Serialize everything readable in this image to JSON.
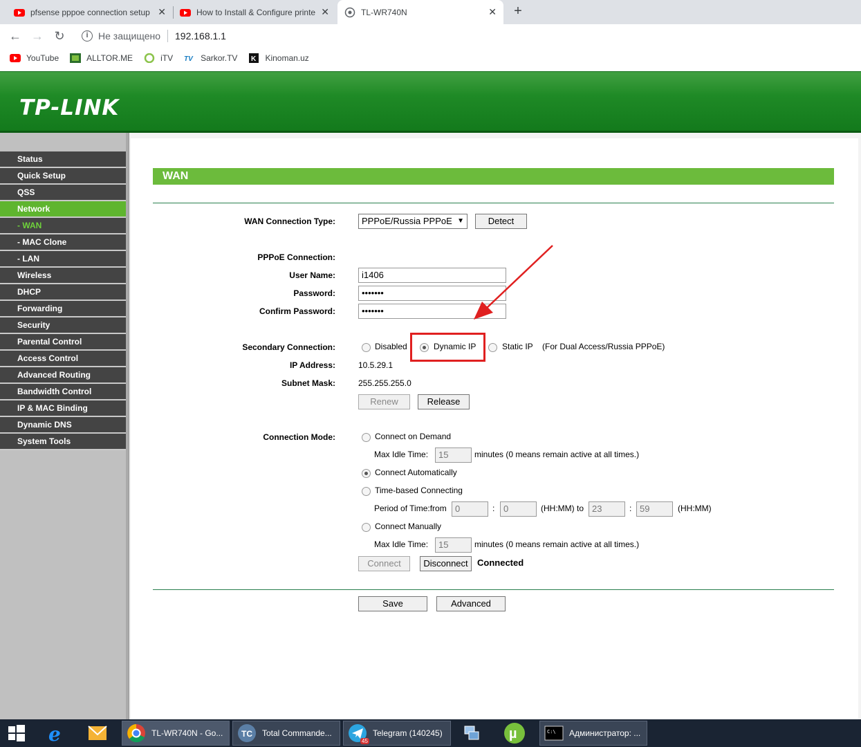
{
  "browser": {
    "tabs": [
      {
        "title": "pfsense pppoe connection setup",
        "icon": "youtube-icon"
      },
      {
        "title": "How to Install & Configure printe",
        "icon": "youtube-icon"
      },
      {
        "title": "TL-WR740N",
        "icon": "globe-icon"
      }
    ],
    "address": {
      "security": "Не защищено",
      "url": "192.168.1.1"
    },
    "bookmarks": [
      {
        "label": "YouTube",
        "icon": "youtube-icon"
      },
      {
        "label": "ALLTOR.ME",
        "icon": "alltor-icon"
      },
      {
        "label": "iTV",
        "icon": "itv-icon"
      },
      {
        "label": "Sarkor.TV",
        "icon": "sarkor-icon"
      },
      {
        "label": "Kinoman.uz",
        "icon": "kinoman-icon"
      }
    ]
  },
  "router": {
    "logo": "TP-LINK",
    "menu": [
      {
        "label": "Status"
      },
      {
        "label": "Quick Setup"
      },
      {
        "label": "QSS"
      },
      {
        "label": "Network"
      },
      {
        "label": "- WAN"
      },
      {
        "label": "- MAC Clone"
      },
      {
        "label": "- LAN"
      },
      {
        "label": "Wireless"
      },
      {
        "label": "DHCP"
      },
      {
        "label": "Forwarding"
      },
      {
        "label": "Security"
      },
      {
        "label": "Parental Control"
      },
      {
        "label": "Access Control"
      },
      {
        "label": "Advanced Routing"
      },
      {
        "label": "Bandwidth Control"
      },
      {
        "label": "IP & MAC Binding"
      },
      {
        "label": "Dynamic DNS"
      },
      {
        "label": "System Tools"
      }
    ],
    "page_title": "WAN",
    "wan_type_label": "WAN Connection Type:",
    "wan_type_value": "PPPoE/Russia PPPoE",
    "detect_label": "Detect",
    "pppoe_heading": "PPPoE Connection:",
    "username_label": "User Name:",
    "username_value": "i1406",
    "password_label": "Password:",
    "password_value": "•••••••",
    "confirm_label": "Confirm Password:",
    "confirm_value": "•••••••",
    "secondary_label": "Secondary Connection:",
    "secondary_options": {
      "disabled": "Disabled",
      "dynamic": "Dynamic IP",
      "static": "Static IP"
    },
    "secondary_note": "(For Dual Access/Russia PPPoE)",
    "ip_label": "IP Address:",
    "ip_value": "10.5.29.1",
    "mask_label": "Subnet Mask:",
    "mask_value": "255.255.255.0",
    "renew_label": "Renew",
    "release_label": "Release",
    "mode_label": "Connection Mode:",
    "mode_on_demand": "Connect on Demand",
    "max_idle_label": "Max Idle Time:",
    "max_idle_value": "15",
    "idle_note": "minutes (0 means remain active at all times.)",
    "mode_auto": "Connect Automatically",
    "mode_time": "Time-based Connecting",
    "period_label": "Period of Time:from",
    "from_h": "0",
    "from_m": "0",
    "hhmm_to": "(HH:MM) to",
    "to_h": "23",
    "to_m": "59",
    "hhmm": "(HH:MM)",
    "colon": ":",
    "mode_manual": "Connect Manually",
    "max_idle_value2": "15",
    "connect_label": "Connect",
    "disconnect_label": "Disconnect",
    "status_text": "Connected",
    "save_label": "Save",
    "advanced_label": "Advanced"
  },
  "taskbar": {
    "items": [
      {
        "label": "TL-WR740N - Go..."
      },
      {
        "label": "Total Commande..."
      },
      {
        "label": "Telegram (140245)"
      },
      {
        "label": "Администратор: ..."
      }
    ],
    "telegram_badge": "45"
  },
  "colors": {
    "accent_green": "#6cbb3c",
    "banner_green": "#1f8a26",
    "highlight_red": "#e02020"
  }
}
